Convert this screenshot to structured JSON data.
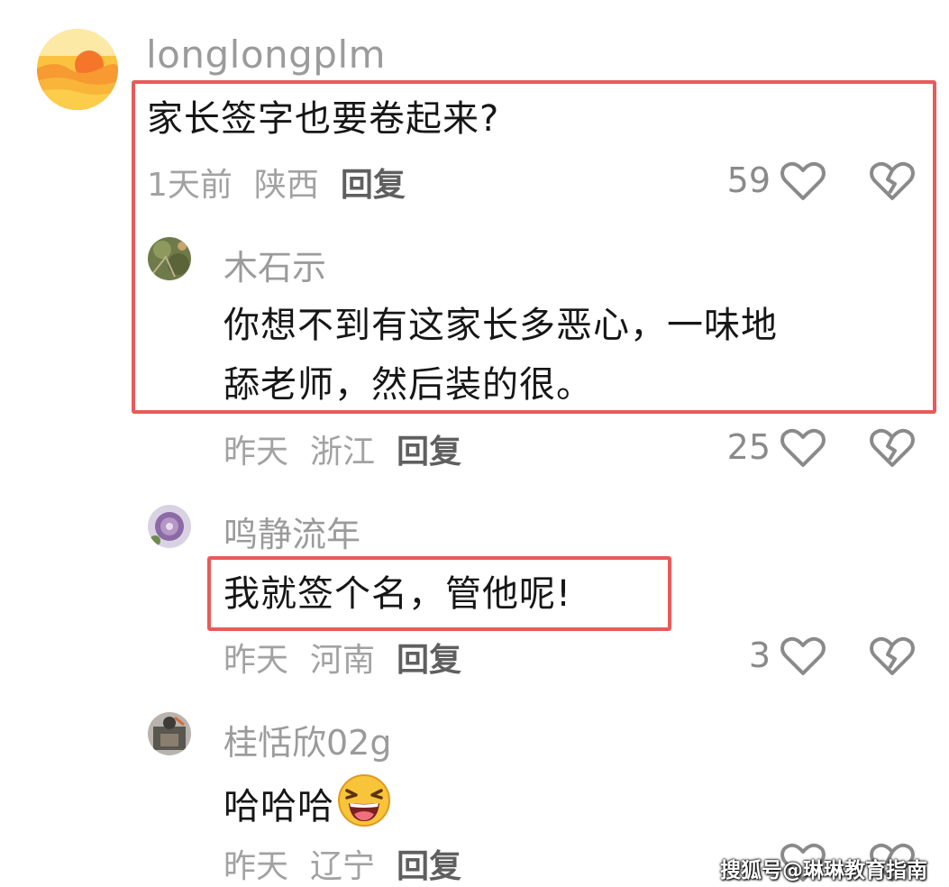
{
  "main_comment": {
    "username": "longlongplm",
    "text": "家长签字也要卷起来?",
    "time": "1天前",
    "region": "陕西",
    "reply_label": "回复",
    "likes": "59"
  },
  "replies": [
    {
      "username": "木石示",
      "text_line1": "你想不到有这家长多恶心，一味地",
      "text_line2": "舔老师，然后装的很。",
      "time": "昨天",
      "region": "浙江",
      "reply_label": "回复",
      "likes": "25"
    },
    {
      "username": "鸣静流年",
      "text": "我就签个名，管他呢!",
      "time": "昨天",
      "region": "河南",
      "reply_label": "回复",
      "likes": "3"
    },
    {
      "username": "桂恬欣02g",
      "text": "哈哈哈",
      "emoji_icon": "laughing-face-emoji",
      "time": "昨天",
      "region": "辽宁",
      "reply_label": "回复"
    }
  ],
  "watermark": "搜狐号@琳琳教育指南",
  "colors": {
    "highlight": "#e95a5a",
    "username": "#9b9b9b",
    "meta": "#a2a2a2"
  },
  "icons": [
    "heart-outline-icon",
    "broken-heart-icon"
  ]
}
